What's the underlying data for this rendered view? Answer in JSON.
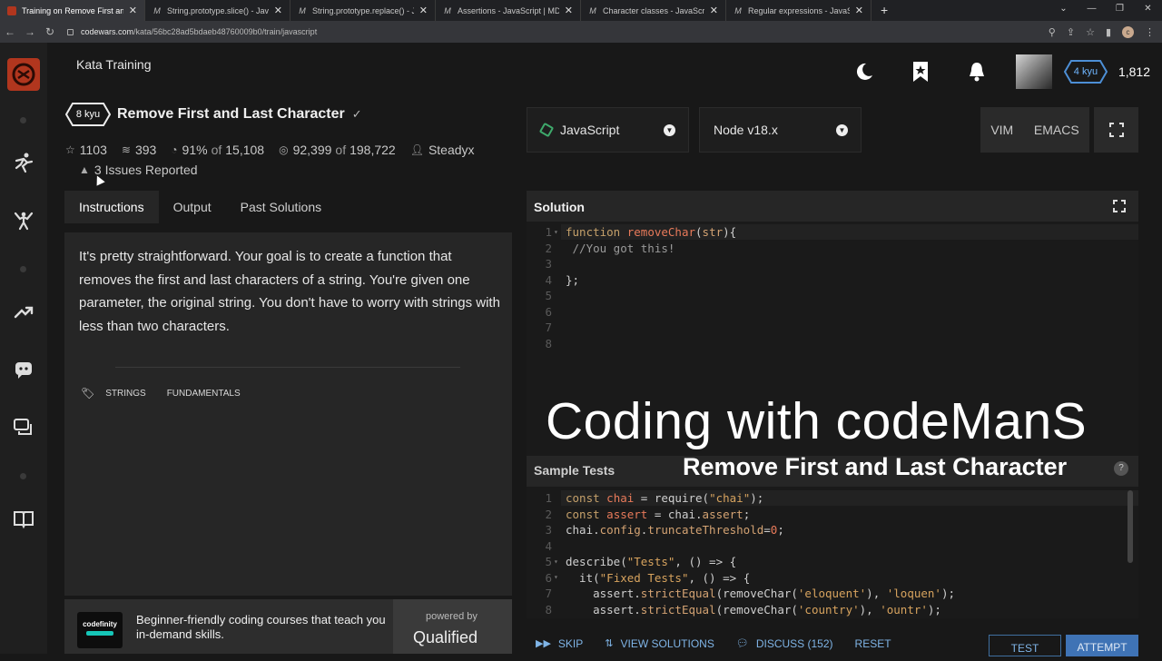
{
  "browser": {
    "tabs": [
      {
        "title": "Training on Remove First and La",
        "active": true
      },
      {
        "title": "String.prototype.slice() - JavaScri",
        "active": false
      },
      {
        "title": "String.prototype.replace() - Java",
        "active": false
      },
      {
        "title": "Assertions - JavaScript | MDN",
        "active": false
      },
      {
        "title": "Character classes - JavaScript | M",
        "active": false
      },
      {
        "title": "Regular expressions - JavaScript",
        "active": false
      }
    ],
    "new_tab": "+",
    "url_domain": "codewars.com",
    "url_path": "/kata/56bc28ad5bdaeb48760009b0/train/javascript",
    "profile_initial": "c"
  },
  "header": {
    "title": "Kata Training",
    "user_rank": "4 kyu",
    "honor": "1,812"
  },
  "kata": {
    "rank": "8 kyu",
    "title": "Remove First and Last Character",
    "stars": "1103",
    "collections": "393",
    "satisfaction": "91%",
    "satisfaction_of": "of",
    "satisfaction_total": "15,108",
    "completed": "92,399",
    "completed_of": "of",
    "completed_total": "198,722",
    "author": "Steadyx",
    "issues": "3 Issues Reported"
  },
  "tabs": [
    "Instructions",
    "Output",
    "Past Solutions"
  ],
  "instructions": "It's pretty straightforward. Your goal is to create a function that removes the first and last characters of a string. You're given one parameter, the original string. You don't have to worry with strings with less than two characters.",
  "tags": [
    "STRINGS",
    "FUNDAMENTALS"
  ],
  "ad": {
    "logo": "codefinity",
    "text": "Beginner-friendly coding courses that teach you in-demand skills.",
    "powered_by": "powered by",
    "brand": "Qualified"
  },
  "editor": {
    "language": "JavaScript",
    "runtime": "Node v18.x",
    "modes": [
      "VIM",
      "EMACS"
    ],
    "solution_label": "Solution",
    "line_numbers": [
      "1",
      "2",
      "3",
      "4",
      "5",
      "6",
      "7",
      "8"
    ],
    "sample_tests_label": "Sample Tests",
    "test_line_numbers": [
      "1",
      "2",
      "3",
      "4",
      "5",
      "6",
      "7",
      "8"
    ]
  },
  "overlay": {
    "line1": "Coding with codeManS",
    "line2": "Remove First and Last Character"
  },
  "actions": {
    "skip": "SKIP",
    "view_solutions": "VIEW SOLUTIONS",
    "discuss": "DISCUSS (152)",
    "reset": "RESET",
    "test": "TEST",
    "attempt": "ATTEMPT"
  }
}
